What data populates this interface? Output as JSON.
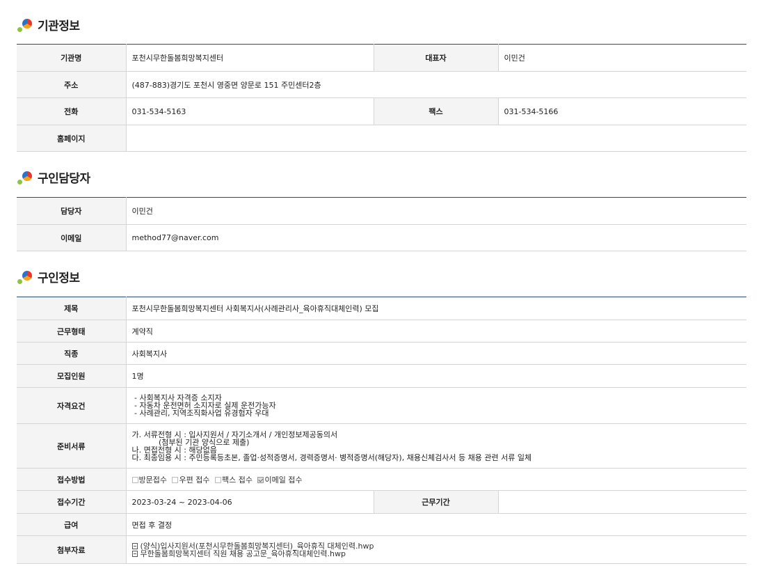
{
  "sections": {
    "org": {
      "title": "기관정보"
    },
    "contact": {
      "title": "구인담당자"
    },
    "job": {
      "title": "구인정보"
    }
  },
  "org": {
    "name_label": "기관명",
    "name": "포천시무한돌봄희망복지센터",
    "rep_label": "대표자",
    "rep": "이민건",
    "address_label": "주소",
    "address": "(487-883)경기도 포천시 영중면 양문로 151 주민센터2층",
    "phone_label": "전화",
    "phone": "031-534-5163",
    "fax_label": "팩스",
    "fax": "031-534-5166",
    "homepage_label": "홈페이지",
    "homepage": ""
  },
  "contact": {
    "person_label": "담당자",
    "person": "이민건",
    "email_label": "이메일",
    "email": "method77@naver.com"
  },
  "job": {
    "title_label": "제목",
    "title": "포천시무한돌봄희망복지센터 사회복지사(사례관리사_육아휴직대체인력) 모집",
    "type_label": "근무형태",
    "type": "계약직",
    "category_label": "직종",
    "category": "사회복지사",
    "headcount_label": "모집인원",
    "headcount": "1명",
    "qualification_label": "자격요건",
    "qualifications": [
      " - 사회복지사 자격증 소지자",
      " - 자동차 운전면허 소지자로 실제 운전가능자",
      " - 사례관리, 지역조직화사업 유경험자 우대"
    ],
    "documents_label": "준비서류",
    "documents": [
      "가. 서류전형 시 : 입사지원서 / 자기소개서 / 개인정보제공동의서",
      "           (첨부된 기관 양식으로 제출)",
      "나. 면접전형 시 : 해당없음",
      "다. 최종임용 시 : 주민등록등초본, 졸업·성적증명서, 경력증명서· 병적증명서(해당자), 채용신체검사서 등 채용 관련 서류 일체"
    ],
    "method_label": "접수방법",
    "methods": [
      {
        "label": "방문접수",
        "checked": false
      },
      {
        "label": "우편 접수",
        "checked": false
      },
      {
        "label": "팩스 접수",
        "checked": false
      },
      {
        "label": "이메일 접수",
        "checked": true
      }
    ],
    "period_label": "접수기간",
    "period": "2023-03-24 ~ 2023-04-06",
    "work_period_label": "근무기간",
    "work_period": "",
    "salary_label": "급여",
    "salary": "면접 후 결정",
    "attachments_label": "첨부자료",
    "attachments": [
      "(양식)입사지원서(포천시무한돌봄희망복지센터)_육아휴직 대체인력.hwp",
      "무한돌봄희망복지센터 직원 채용 공고문_육아휴직대체인력.hwp"
    ]
  }
}
